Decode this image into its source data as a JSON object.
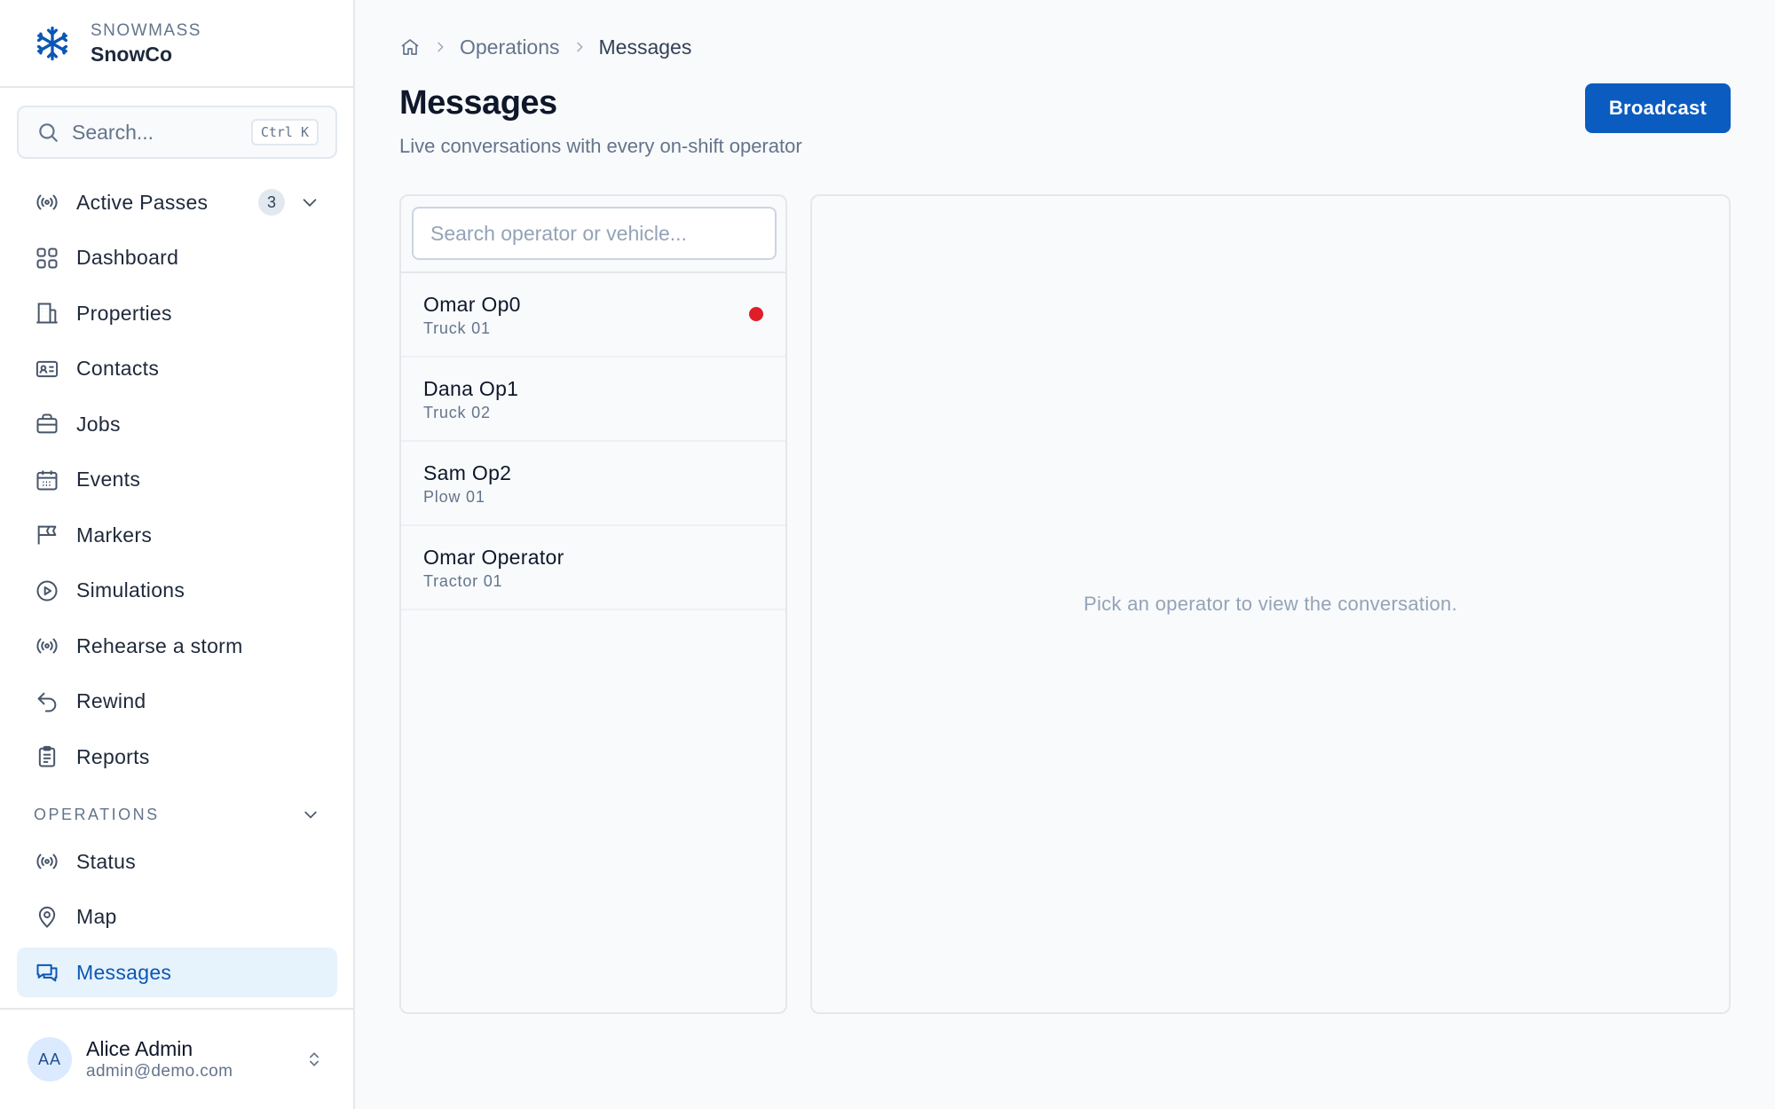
{
  "brand": {
    "org": "SNOWMASS",
    "name": "SnowCo",
    "icon": "snowflake-icon"
  },
  "search": {
    "placeholder": "Search...",
    "shortcut": "Ctrl K"
  },
  "nav": {
    "active_passes": {
      "label": "Active Passes",
      "count": "3"
    },
    "items": [
      {
        "label": "Dashboard"
      },
      {
        "label": "Properties"
      },
      {
        "label": "Contacts"
      },
      {
        "label": "Jobs"
      },
      {
        "label": "Events"
      },
      {
        "label": "Markers"
      },
      {
        "label": "Simulations"
      },
      {
        "label": "Rehearse a storm"
      },
      {
        "label": "Rewind"
      },
      {
        "label": "Reports"
      }
    ],
    "operations_section": "OPERATIONS",
    "operations": [
      {
        "label": "Status"
      },
      {
        "label": "Map"
      },
      {
        "label": "Messages"
      }
    ]
  },
  "user": {
    "initials": "AA",
    "name": "Alice Admin",
    "email": "admin@demo.com"
  },
  "breadcrumb": {
    "section": "Operations",
    "current": "Messages"
  },
  "page": {
    "title": "Messages",
    "subtitle": "Live conversations with every on-shift operator",
    "broadcast_label": "Broadcast"
  },
  "operators": {
    "search_placeholder": "Search operator or vehicle...",
    "list": [
      {
        "name": "Omar Op0",
        "vehicle": "Truck 01",
        "unread": true
      },
      {
        "name": "Dana Op1",
        "vehicle": "Truck 02",
        "unread": false
      },
      {
        "name": "Sam Op2",
        "vehicle": "Plow 01",
        "unread": false
      },
      {
        "name": "Omar Operator",
        "vehicle": "Tractor 01",
        "unread": false
      }
    ]
  },
  "conversation": {
    "empty_text": "Pick an operator to view the conversation."
  },
  "colors": {
    "accent": "#0b5cc0",
    "active_bg": "#e6f2fc",
    "unread": "#e11d2a"
  }
}
